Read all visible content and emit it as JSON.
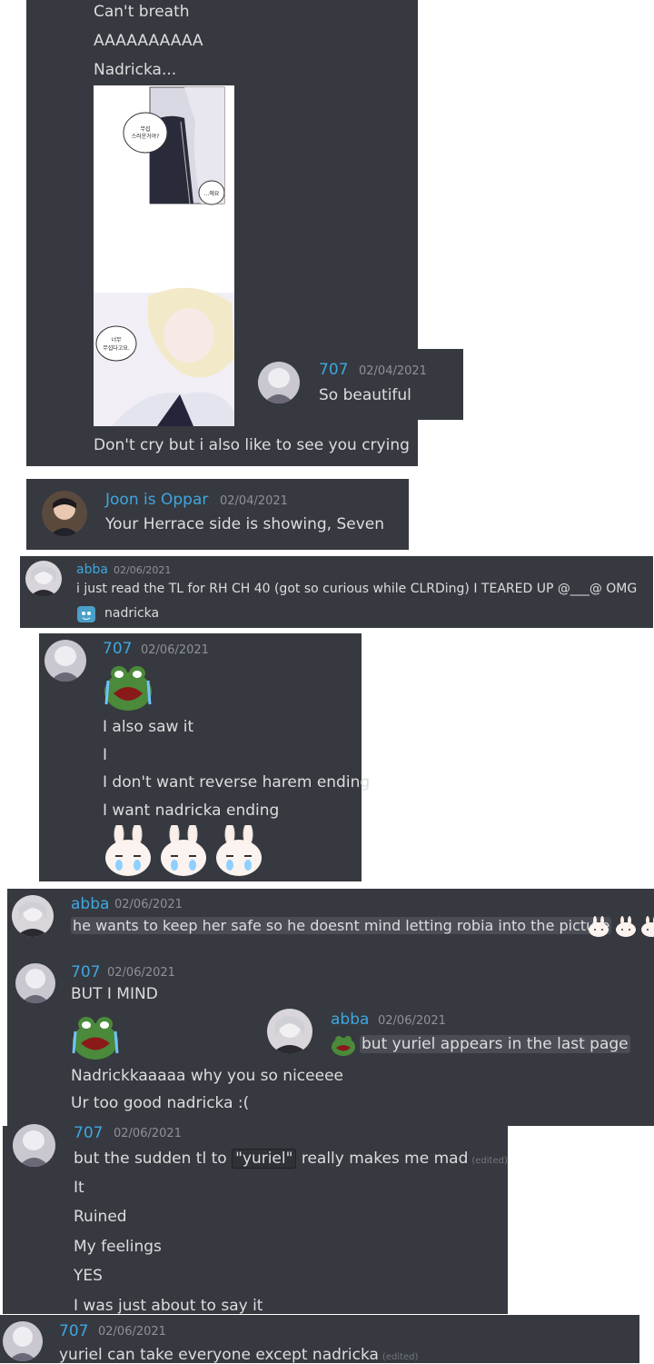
{
  "block1": {
    "lines": [
      "Can't breath",
      "AAAAAAAAAA",
      "Nadricka...",
      "Don't cry but i also like to see you crying"
    ],
    "manhwa_bubbles": [
      "무섭\n스러운거야?",
      "...에요",
      "너무\n무섭다고요."
    ]
  },
  "reply_seven": {
    "name": "707",
    "time": "02/04/2021",
    "text": "So beautiful"
  },
  "joon": {
    "name": "Joon is Oppar",
    "time": "02/04/2021",
    "text": "Your Herrace side is showing, Seven"
  },
  "abba1": {
    "name": "abba",
    "time": "02/06/2021",
    "text": "i just read the TL for RH CH 40 (got so curious while CLRDing) I TEARED UP @___@ OMG",
    "reaction": "nadricka"
  },
  "seven2": {
    "name": "707",
    "time": "02/06/2021",
    "lines": [
      "I also saw it",
      "I",
      "I don't want reverse harem ending",
      "I want nadricka ending"
    ]
  },
  "abba2": {
    "name": "abba",
    "time": "02/06/2021",
    "text": "he wants to keep her safe so he doesnt mind letting robia into the picture"
  },
  "seven3": {
    "name": "707",
    "time": "02/06/2021",
    "lines": [
      "BUT I MIND",
      "Nadrickkaaaaa why you so niceeee",
      "Ur too good nadricka :("
    ]
  },
  "abba3": {
    "name": "abba",
    "time": "02/06/2021",
    "text": "but yuriel appears in the last page"
  },
  "seven4": {
    "name": "707",
    "time": "02/06/2021",
    "line1_pre": "but the sudden tl to",
    "line1_code": "\"yuriel\"",
    "line1_post": "really makes me mad",
    "edited": "(edited)",
    "lines": [
      "It",
      "Ruined",
      "My feelings",
      "YES",
      "I was just about to say it"
    ]
  },
  "seven5": {
    "name": "707",
    "time": "02/06/2021",
    "text": "yuriel can take everyone except nadricka",
    "edited": "(edited)"
  },
  "colors": {
    "panel_bg": "#36393f",
    "username": "#3fa7e0",
    "timestamp": "#8e9297",
    "text": "#dcddde"
  }
}
